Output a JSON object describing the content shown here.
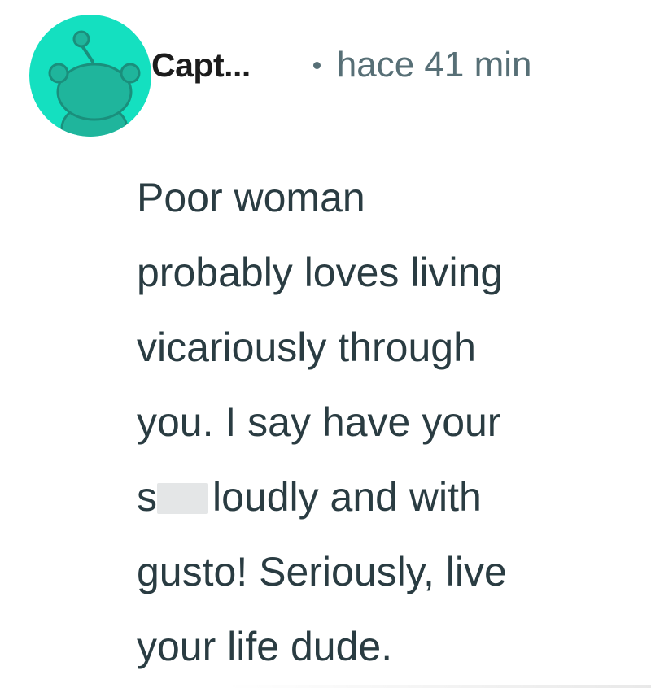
{
  "comment": {
    "author": "Capt...",
    "separator": "•",
    "timestamp": "hace 41 min",
    "avatar_icon": "reddit-snoo-avatar-icon",
    "avatar_color": "#14e0c0",
    "body_lines": [
      "Poor woman",
      "probably loves living",
      "vicariously through",
      "you. I say have your",
      "loudly and with",
      "gusto! Seriously, live",
      "your life dude."
    ],
    "redacted_prefix": "s"
  },
  "colors": {
    "username": "#1c1c1c",
    "meta": "#576f76",
    "body_text": "#2a3c42",
    "redaction": "#e4e6e7"
  }
}
